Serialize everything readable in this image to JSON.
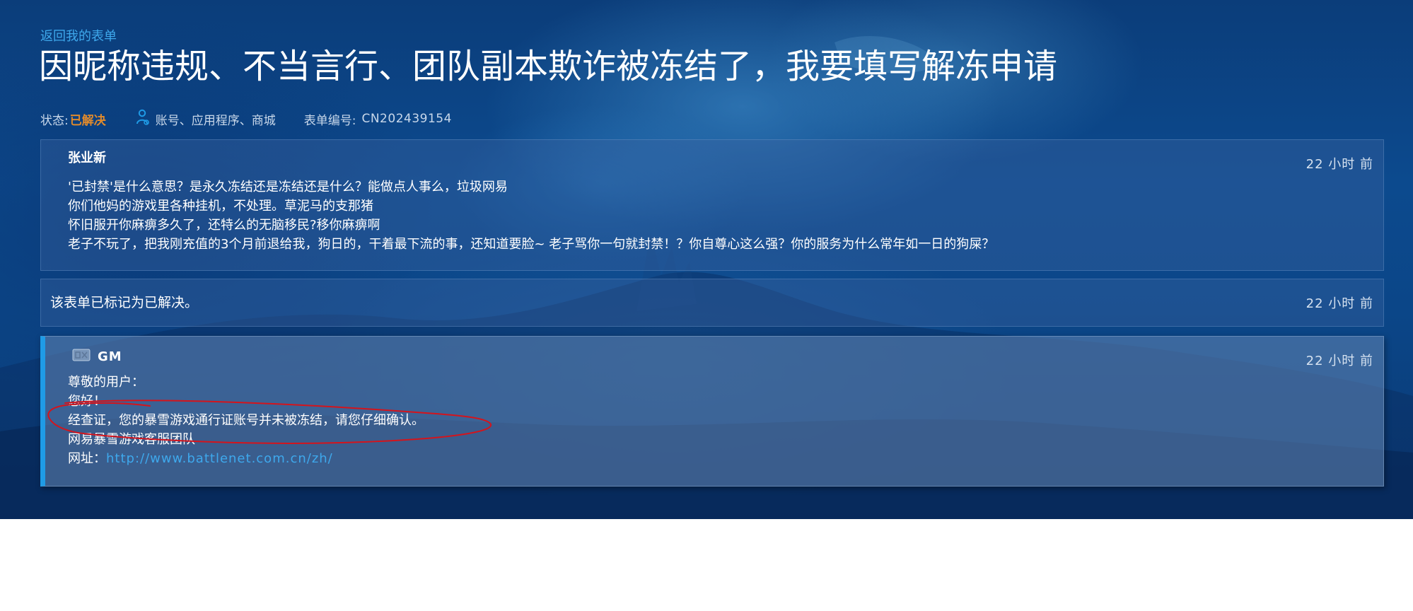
{
  "header": {
    "back_link": "返回我的表单",
    "title": "因昵称违规、不当言行、团队副本欺诈被冻结了，我要填写解冻申请"
  },
  "meta": {
    "status_label": "状态:",
    "status_value": "已解决",
    "category": "账号、应用程序、商城",
    "ticket_label": "表单编号:",
    "ticket_number": "CN202439154",
    "icon": "user-gear-icon"
  },
  "colors": {
    "accent": "#1f9be6",
    "link": "#3ea8ec",
    "status": "#e08a2c",
    "annotation": "#d4141c"
  },
  "messages": {
    "user": {
      "author": "张业新",
      "timestamp": "22 小时 前",
      "lines": [
        "'已封禁'是什么意思？是永久冻结还是冻结还是什么？能做点人事么，垃圾网易",
        "你们他妈的游戏里各种挂机，不处理。草泥马的支那猪",
        "怀旧服开你麻痹多久了，还特么的无脑移民?移你麻痹啊",
        "老子不玩了，把我刚充值的3个月前退给我，狗日的，干着最下流的事，还知道要脸~ 老子骂你一句就封禁！？你自尊心这么强？你的服务为什么常年如一日的狗屎？"
      ]
    },
    "system": {
      "text": "该表单已标记为已解决。",
      "timestamp": "22 小时 前"
    },
    "gm": {
      "author": "GM",
      "timestamp": "22 小时 前",
      "icon": "gm-badge-icon",
      "lines": [
        "尊敬的用户：",
        "您好！",
        "经查证，您的暴雪游戏通行证账号并未被冻结，请您仔细确认。",
        "网易暴雪游戏客服团队"
      ],
      "url_label": "网址：",
      "url": "http://www.battlenet.com.cn/zh/"
    }
  }
}
